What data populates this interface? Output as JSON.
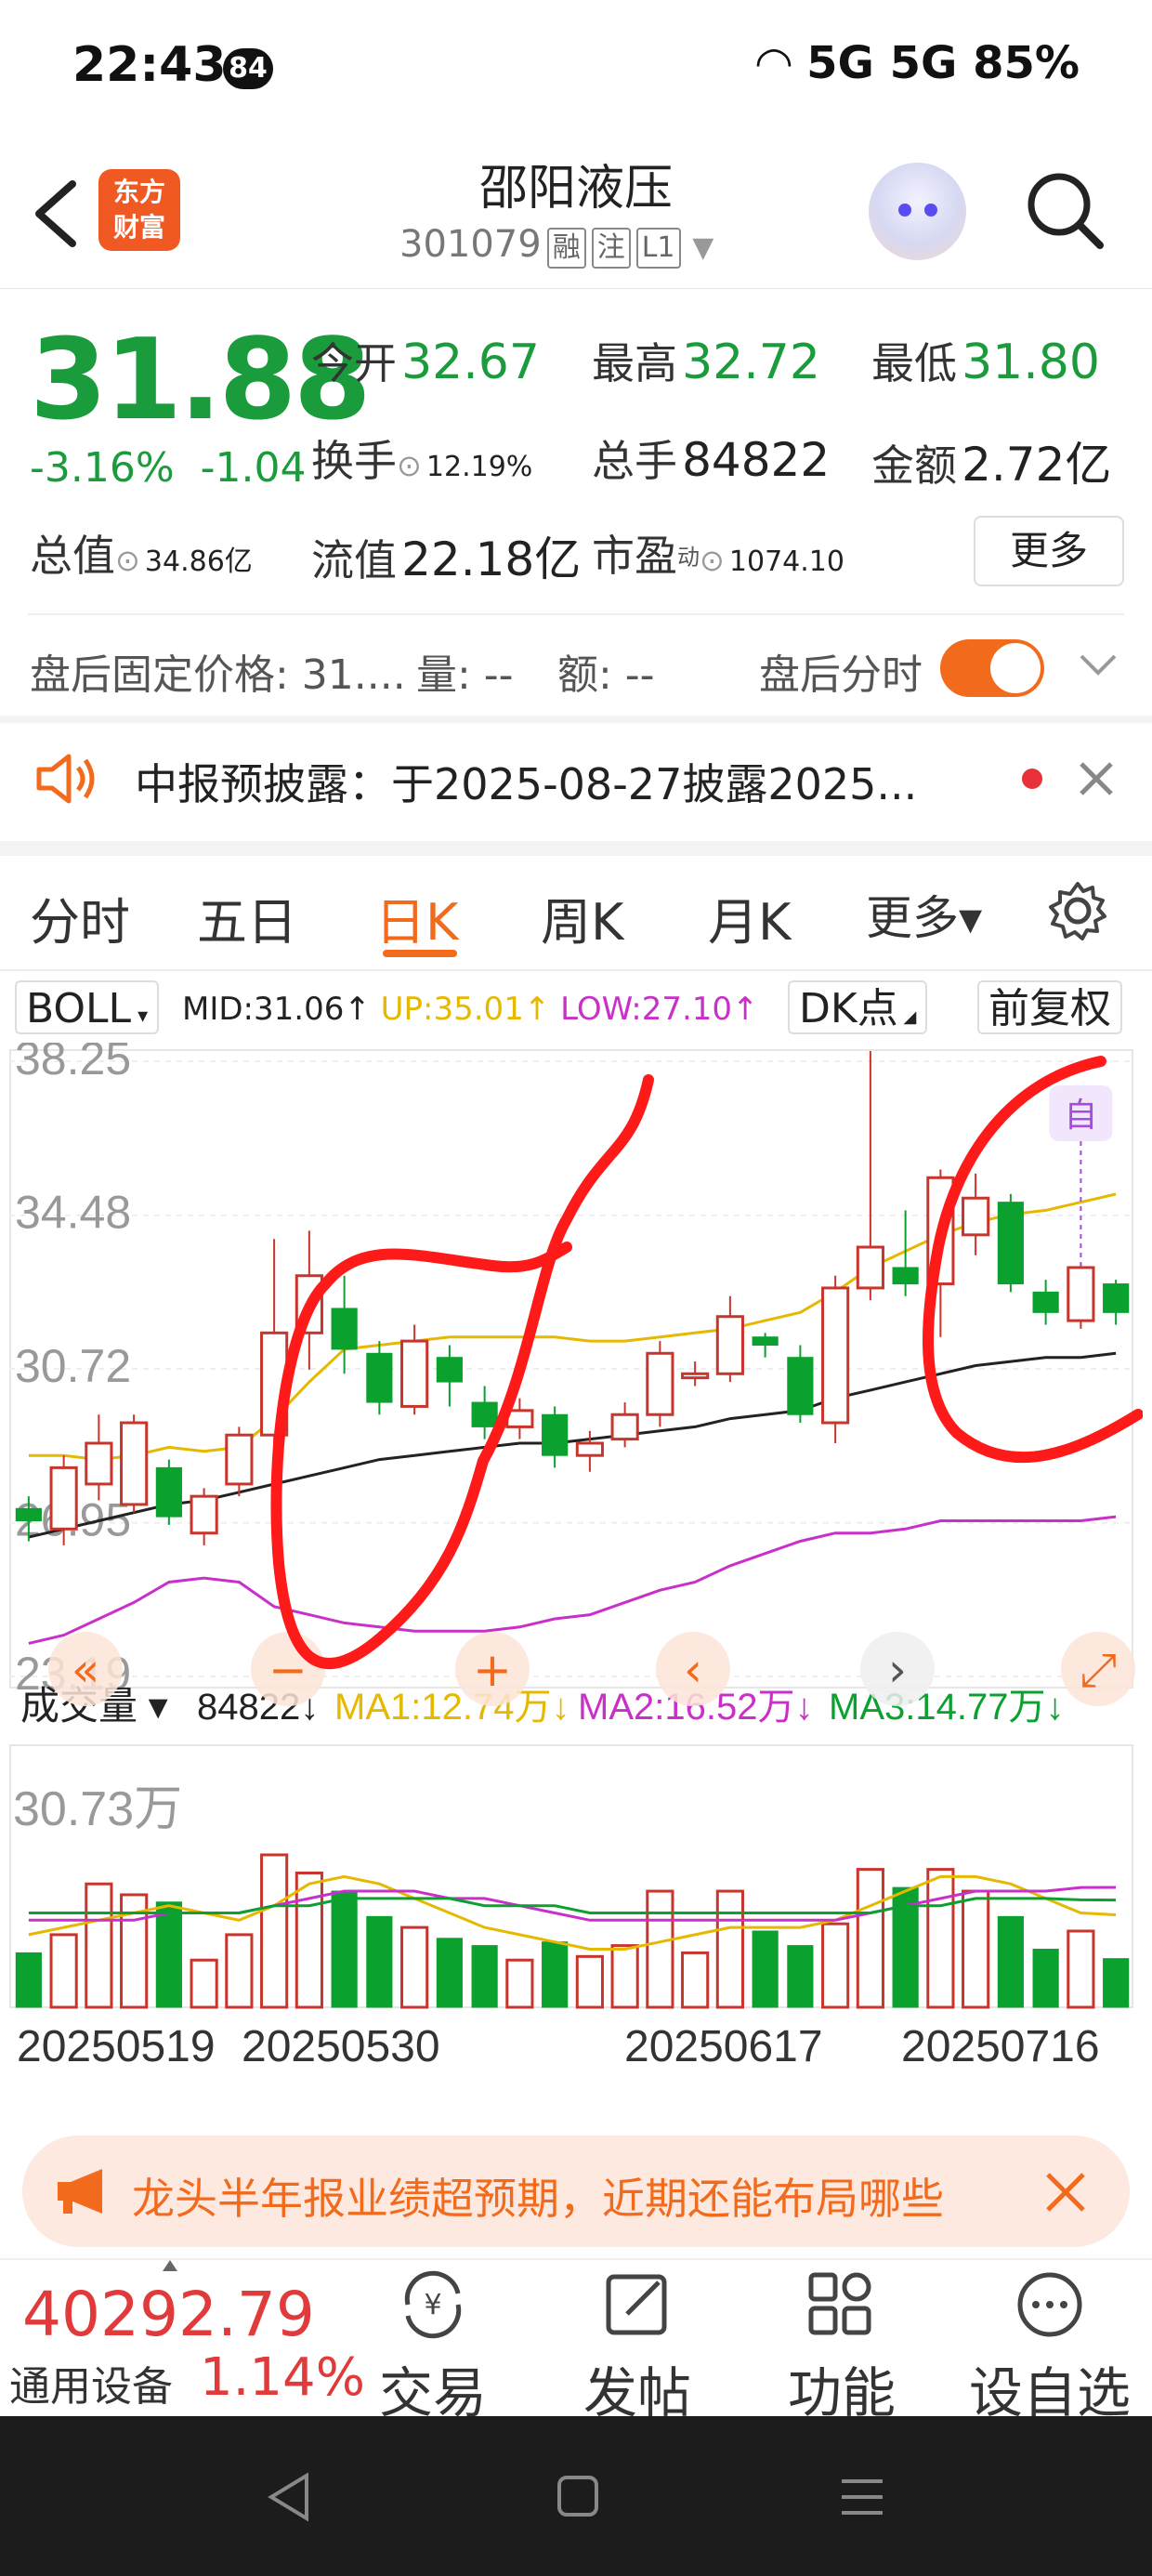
{
  "status_bar": {
    "time": "22:43",
    "badge": "84",
    "right": "5G 5G 85%"
  },
  "header": {
    "title": "邵阳液压",
    "code": "301079",
    "tags": [
      "融",
      "注",
      "L1"
    ],
    "logo_line1": "东方",
    "logo_line2": "财富"
  },
  "quote": {
    "price": "31.88",
    "change_pct": "-3.16%",
    "change": "-1.04",
    "open_label": "今开",
    "open": "32.67",
    "high_label": "最高",
    "high": "32.72",
    "low_label": "最低",
    "low": "31.80",
    "turnover_label": "换手",
    "turnover": "12.19%",
    "volume_label": "总手",
    "volume": "84822",
    "amount_label": "金额",
    "amount": "2.72亿",
    "mktcap_label": "总值",
    "mktcap": "34.86亿",
    "float_label": "流值",
    "float": "22.18亿",
    "pe_label": "市盈",
    "pe_sup": "动",
    "pe": "1074.10",
    "more": "更多"
  },
  "after_hours": {
    "fixed_price": "盘后固定价格: 31....",
    "vol": "量: --",
    "amt": "额: --",
    "toggle_label": "盘后分时"
  },
  "notice": {
    "text": "中报预披露：于2025-08-27披露2025..."
  },
  "tabs": [
    "分时",
    "五日",
    "日K",
    "周K",
    "月K",
    "更多▾"
  ],
  "indicator": {
    "name": "BOLL",
    "mid": "MID:31.06↑",
    "up": "UP:35.01↑",
    "low": "LOW:27.10↑",
    "dk": "DK点",
    "adj": "前复权"
  },
  "volume_panel": {
    "name": "成交量",
    "vol": "84822↓",
    "ma1": "MA1:12.74万↓",
    "ma2": "MA2:16.52万↓",
    "ma3": "MA3:14.77万↓",
    "max_label": "30.73万"
  },
  "chart_data": {
    "type": "candlestick",
    "y_ticks": [
      "38.25",
      "34.48",
      "30.72",
      "26.95",
      "23.19"
    ],
    "ylim": [
      23.19,
      38.25
    ],
    "x_labels": [
      "20250519",
      "20250530",
      "20250617",
      "20250716"
    ],
    "candles": [
      {
        "o": 27.3,
        "c": 27.0,
        "h": 27.6,
        "l": 26.5,
        "v": 7.5
      },
      {
        "o": 26.8,
        "c": 28.3,
        "h": 28.6,
        "l": 26.4,
        "v": 10
      },
      {
        "o": 27.9,
        "c": 28.9,
        "h": 29.6,
        "l": 27.5,
        "v": 17
      },
      {
        "o": 27.4,
        "c": 29.4,
        "h": 29.6,
        "l": 27.2,
        "v": 15.5
      },
      {
        "o": 28.3,
        "c": 27.1,
        "h": 28.5,
        "l": 26.9,
        "v": 14.5
      },
      {
        "o": 26.7,
        "c": 27.6,
        "h": 27.8,
        "l": 26.4,
        "v": 6.5
      },
      {
        "o": 27.9,
        "c": 29.1,
        "h": 29.3,
        "l": 27.6,
        "v": 10
      },
      {
        "o": 29.1,
        "c": 31.6,
        "h": 33.9,
        "l": 28.9,
        "v": 21
      },
      {
        "o": 31.6,
        "c": 33.0,
        "h": 34.1,
        "l": 30.7,
        "v": 18.5
      },
      {
        "o": 32.2,
        "c": 31.2,
        "h": 33.0,
        "l": 30.6,
        "v": 16
      },
      {
        "o": 31.1,
        "c": 29.9,
        "h": 31.4,
        "l": 29.6,
        "v": 12.5
      },
      {
        "o": 29.8,
        "c": 31.4,
        "h": 31.8,
        "l": 29.6,
        "v": 11
      },
      {
        "o": 31.0,
        "c": 30.4,
        "h": 31.3,
        "l": 29.8,
        "v": 9.5
      },
      {
        "o": 29.9,
        "c": 29.3,
        "h": 30.3,
        "l": 29.0,
        "v": 8.5
      },
      {
        "o": 29.3,
        "c": 29.7,
        "h": 30.0,
        "l": 29.0,
        "v": 6.5
      },
      {
        "o": 29.6,
        "c": 28.6,
        "h": 29.8,
        "l": 28.3,
        "v": 9
      },
      {
        "o": 28.6,
        "c": 28.9,
        "h": 29.2,
        "l": 28.2,
        "v": 7
      },
      {
        "o": 29.0,
        "c": 29.6,
        "h": 29.9,
        "l": 28.8,
        "v": 8.5
      },
      {
        "o": 29.6,
        "c": 31.1,
        "h": 31.4,
        "l": 29.3,
        "v": 16
      },
      {
        "o": 30.5,
        "c": 30.6,
        "h": 30.9,
        "l": 30.3,
        "v": 7.5
      },
      {
        "o": 30.6,
        "c": 32.0,
        "h": 32.5,
        "l": 30.4,
        "v": 16
      },
      {
        "o": 31.5,
        "c": 31.3,
        "h": 31.6,
        "l": 31.0,
        "v": 10.5
      },
      {
        "o": 31.0,
        "c": 29.6,
        "h": 31.3,
        "l": 29.4,
        "v": 8.5
      },
      {
        "o": 29.4,
        "c": 32.7,
        "h": 33.0,
        "l": 28.9,
        "v": 11.5
      },
      {
        "o": 32.7,
        "c": 33.7,
        "h": 38.5,
        "l": 32.4,
        "v": 19
      },
      {
        "o": 33.2,
        "c": 32.8,
        "h": 34.6,
        "l": 32.5,
        "v": 16.5
      },
      {
        "o": 32.8,
        "c": 35.4,
        "h": 35.6,
        "l": 31.5,
        "v": 19
      },
      {
        "o": 34.0,
        "c": 34.9,
        "h": 35.5,
        "l": 33.5,
        "v": 16
      },
      {
        "o": 34.8,
        "c": 32.8,
        "h": 35.0,
        "l": 32.6,
        "v": 12.5
      },
      {
        "o": 32.6,
        "c": 32.1,
        "h": 32.9,
        "l": 31.8,
        "v": 8
      },
      {
        "o": 31.9,
        "c": 33.2,
        "h": 33.3,
        "l": 31.7,
        "v": 10.5
      },
      {
        "o": 32.8,
        "c": 32.1,
        "h": 32.9,
        "l": 31.8,
        "v": 6.7
      }
    ],
    "boll_up": [
      28.6,
      28.6,
      28.5,
      28.6,
      28.8,
      28.7,
      28.8,
      29.5,
      30.4,
      31.2,
      31.3,
      31.4,
      31.5,
      31.5,
      31.5,
      31.5,
      31.4,
      31.4,
      31.5,
      31.6,
      31.7,
      31.9,
      32.1,
      32.6,
      33.2,
      33.6,
      34.0,
      34.3,
      34.5,
      34.6,
      34.8,
      35.0
    ],
    "boll_mid": [
      26.6,
      26.8,
      27.0,
      27.2,
      27.4,
      27.5,
      27.7,
      27.9,
      28.1,
      28.3,
      28.5,
      28.6,
      28.7,
      28.8,
      28.9,
      28.9,
      29.0,
      29.1,
      29.2,
      29.3,
      29.5,
      29.6,
      29.7,
      30.0,
      30.2,
      30.4,
      30.6,
      30.8,
      30.9,
      31.0,
      31.0,
      31.1
    ],
    "boll_low": [
      24.0,
      24.2,
      24.6,
      25.0,
      25.5,
      25.6,
      25.5,
      24.9,
      24.7,
      24.5,
      24.4,
      24.3,
      24.3,
      24.3,
      24.4,
      24.6,
      24.7,
      25.0,
      25.3,
      25.5,
      25.9,
      26.2,
      26.5,
      26.7,
      26.7,
      26.8,
      27.0,
      27.0,
      27.0,
      27.0,
      27.0,
      27.1
    ],
    "vol_max": 30.73,
    "vol_ma1": [
      10,
      11,
      12,
      13,
      14,
      13,
      12,
      14,
      17,
      18,
      17,
      15,
      13,
      11,
      10,
      9,
      8,
      8,
      9,
      10,
      11,
      11,
      11,
      12,
      14,
      16,
      18,
      18,
      17,
      15,
      13,
      12.74
    ],
    "vol_ma2": [
      12,
      12,
      12,
      12,
      13,
      13,
      13,
      14,
      15,
      16,
      16,
      16,
      15,
      15,
      14,
      13,
      12,
      12,
      12,
      12,
      12,
      12,
      12,
      12,
      13,
      14,
      15,
      16,
      16,
      16,
      16.5,
      16.52
    ],
    "vol_ma3": [
      13,
      13,
      13,
      13,
      13,
      13,
      13,
      14,
      14,
      15,
      15,
      15,
      15,
      14,
      14,
      14,
      13,
      13,
      13,
      13,
      13,
      13,
      13,
      13,
      13,
      14,
      14,
      15,
      15,
      15,
      14.8,
      14.77
    ]
  },
  "colors": {
    "up": "#c8352c",
    "down": "#0aa12e",
    "mid": "#222222",
    "upband": "#e6b800",
    "lowband": "#c930c9",
    "accent": "#f26b1d",
    "ma1": "#e6b800",
    "ma2": "#c930c9",
    "ma3": "#0aa12e"
  },
  "chart_controls": [
    "«",
    "−",
    "+",
    "‹",
    "›",
    "⤢"
  ],
  "chart_flag": "自",
  "banner": {
    "text": "龙头半年报业绩超预期，近期还能布局哪些"
  },
  "bottom_nav": {
    "index_value": "40292.79",
    "index_name": "通用设备",
    "index_pct": "1.14%",
    "items": [
      "交易",
      "发帖",
      "功能",
      "设自选"
    ]
  }
}
